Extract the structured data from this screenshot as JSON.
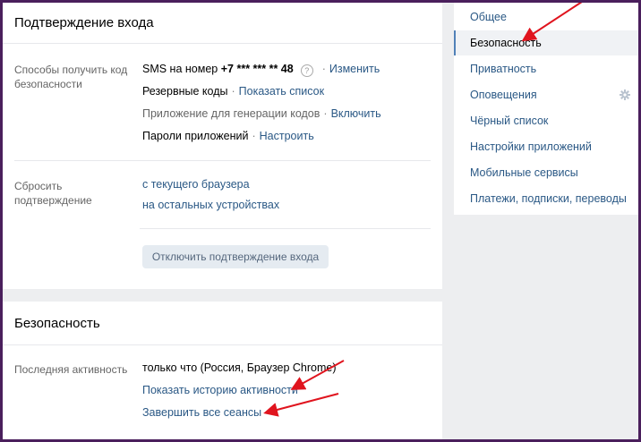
{
  "login_confirmation": {
    "title": "Подтверждение входа",
    "methods_label": "Способы получить код безопасности",
    "sms_prefix": "SMS на номер",
    "sms_number": "+7 *** *** ** 48",
    "help_icon": "question-icon",
    "change_link": "Изменить",
    "backup_codes": "Резервные коды",
    "show_list_link": "Показать список",
    "app_codes": "Приложение для генерации кодов",
    "enable_link": "Включить",
    "app_passwords": "Пароли приложений",
    "configure_link": "Настроить",
    "separator": "·",
    "reset_label": "Сбросить подтверждение",
    "reset_current_browser": "с текущего браузера",
    "reset_other_devices": "на остальных устройствах",
    "disable_button": "Отключить подтверждение входа"
  },
  "security": {
    "title": "Безопасность",
    "last_activity_label": "Последняя активность",
    "last_activity_value": "только что (Россия, Браузер Chrome)",
    "show_history_link": "Показать историю активности",
    "end_sessions_link": "Завершить все сеансы"
  },
  "menu": {
    "items": [
      {
        "label": "Общее"
      },
      {
        "label": "Безопасность"
      },
      {
        "label": "Приватность"
      },
      {
        "label": "Оповещения"
      },
      {
        "label": "Чёрный список"
      },
      {
        "label": "Настройки приложений"
      },
      {
        "label": "Мобильные сервисы"
      },
      {
        "label": "Платежи, подписки, переводы"
      }
    ],
    "active_index": 1,
    "notifications_icon": "gear-icon"
  },
  "colors": {
    "link": "#2a5885",
    "annotation_arrow": "#e0141e",
    "frame": "#4a1f5c",
    "active_marker": "#5181b8"
  }
}
